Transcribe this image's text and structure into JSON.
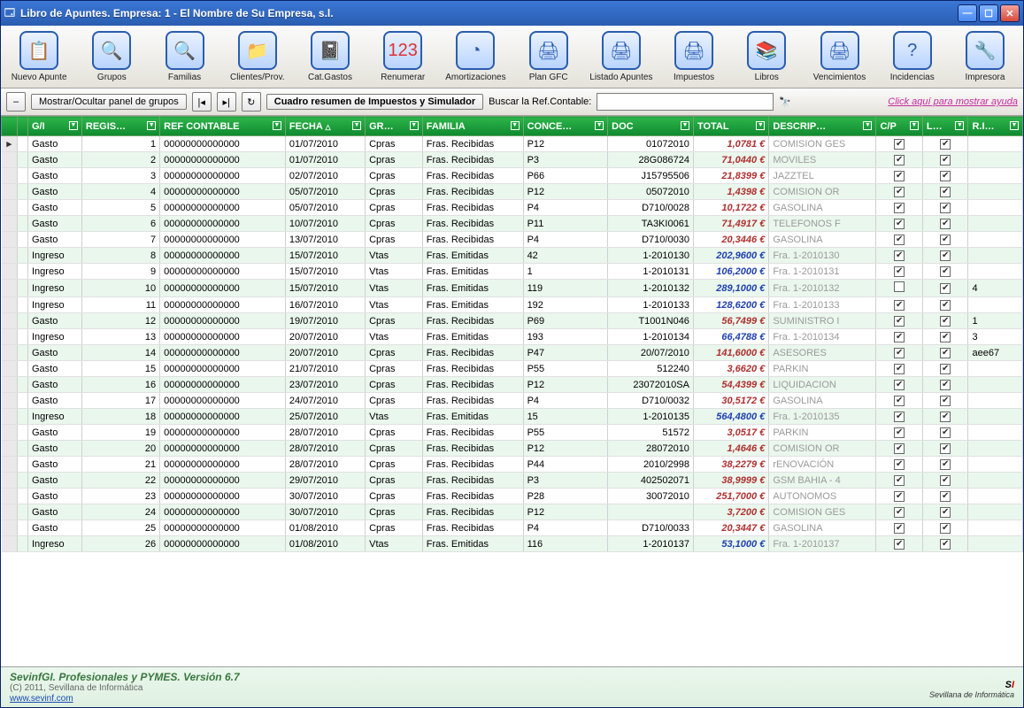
{
  "window": {
    "title": "Libro de Apuntes. Empresa: 1 - El Nombre de Su Empresa, s.l."
  },
  "toolbar_items": [
    {
      "label": "Nuevo Apunte",
      "icon": "📋",
      "name": "nuevo-apunte"
    },
    {
      "label": "Grupos",
      "icon": "🔍",
      "name": "grupos"
    },
    {
      "label": "Familias",
      "icon": "🔍",
      "name": "familias"
    },
    {
      "label": "Clientes/Prov.",
      "icon": "📁",
      "name": "clientes-prov"
    },
    {
      "label": "Cat.Gastos",
      "icon": "📓",
      "name": "cat-gastos"
    },
    {
      "label": "Renumerar",
      "icon": "123",
      "name": "renumerar",
      "red": true
    },
    {
      "label": "Amortizaciones",
      "icon": "◔",
      "name": "amortizaciones"
    },
    {
      "label": "Plan GFC",
      "icon": "🖨",
      "name": "plan-gfc"
    },
    {
      "label": "Listado Apuntes",
      "icon": "🖨",
      "name": "listado-apuntes"
    },
    {
      "label": "Impuestos",
      "icon": "🖨",
      "name": "impuestos"
    },
    {
      "label": "Libros",
      "icon": "📚",
      "name": "libros"
    },
    {
      "label": "Vencimientos",
      "icon": "🖨",
      "name": "vencimientos"
    },
    {
      "label": "Incidencias",
      "icon": "?",
      "name": "incidencias"
    },
    {
      "label": "Impresora",
      "icon": "🔧",
      "name": "impresora"
    }
  ],
  "toolbar2": {
    "toggle_panel": "Mostrar/Ocultar panel de grupos",
    "cuadro": "Cuadro resumen de Impuestos y Simulador",
    "buscar_label": "Buscar la Ref.Contable:",
    "help": "Click aquí para mostrar ayuda"
  },
  "columns": [
    "",
    "",
    "G/I",
    "REGIS…",
    "REF CONTABLE",
    "FECHA",
    "GR…",
    "FAMILIA",
    "CONCE…",
    "DOC",
    "TOTAL",
    "DESCRIP…",
    "C/P",
    "L…",
    "R.I…"
  ],
  "rows": [
    {
      "sel": true,
      "gi": "Gasto",
      "reg": 1,
      "ref": "00000000000000",
      "fecha": "01/07/2010",
      "gr": "Cpras",
      "familia": "Fras. Recibidas",
      "conc": "P12",
      "doc": "01072010",
      "total": "1,0781 €",
      "tc": "red",
      "desc": "COMISION GES",
      "cp": true,
      "l": true,
      "ri": ""
    },
    {
      "gi": "Gasto",
      "reg": 2,
      "ref": "00000000000000",
      "fecha": "01/07/2010",
      "gr": "Cpras",
      "familia": "Fras. Recibidas",
      "conc": "P3",
      "doc": "28G086724",
      "total": "71,0440 €",
      "tc": "red",
      "desc": "MOVILES",
      "cp": true,
      "l": true,
      "ri": ""
    },
    {
      "gi": "Gasto",
      "reg": 3,
      "ref": "00000000000000",
      "fecha": "02/07/2010",
      "gr": "Cpras",
      "familia": "Fras. Recibidas",
      "conc": "P66",
      "doc": "J15795506",
      "total": "21,8399 €",
      "tc": "red",
      "desc": "JAZZTEL",
      "cp": true,
      "l": true,
      "ri": ""
    },
    {
      "gi": "Gasto",
      "reg": 4,
      "ref": "00000000000000",
      "fecha": "05/07/2010",
      "gr": "Cpras",
      "familia": "Fras. Recibidas",
      "conc": "P12",
      "doc": "05072010",
      "total": "1,4398 €",
      "tc": "red",
      "desc": "COMISION OR",
      "cp": true,
      "l": true,
      "ri": ""
    },
    {
      "gi": "Gasto",
      "reg": 5,
      "ref": "00000000000000",
      "fecha": "05/07/2010",
      "gr": "Cpras",
      "familia": "Fras. Recibidas",
      "conc": "P4",
      "doc": "D710/0028",
      "total": "10,1722 €",
      "tc": "red",
      "desc": "GASOLINA",
      "cp": true,
      "l": true,
      "ri": ""
    },
    {
      "gi": "Gasto",
      "reg": 6,
      "ref": "00000000000000",
      "fecha": "10/07/2010",
      "gr": "Cpras",
      "familia": "Fras. Recibidas",
      "conc": "P11",
      "doc": "TA3KI0061",
      "total": "71,4917 €",
      "tc": "red",
      "desc": "TELEFONOS F",
      "cp": true,
      "l": true,
      "ri": ""
    },
    {
      "gi": "Gasto",
      "reg": 7,
      "ref": "00000000000000",
      "fecha": "13/07/2010",
      "gr": "Cpras",
      "familia": "Fras. Recibidas",
      "conc": "P4",
      "doc": "D710/0030",
      "total": "20,3446 €",
      "tc": "red",
      "desc": "GASOLINA",
      "cp": true,
      "l": true,
      "ri": ""
    },
    {
      "gi": "Ingreso",
      "reg": 8,
      "ref": "00000000000000",
      "fecha": "15/07/2010",
      "gr": "Vtas",
      "familia": "Fras. Emitidas",
      "conc": "42",
      "doc": "1-2010130",
      "total": "202,9600 €",
      "tc": "blue",
      "desc": "Fra. 1-2010130",
      "cp": true,
      "l": true,
      "ri": ""
    },
    {
      "gi": "Ingreso",
      "reg": 9,
      "ref": "00000000000000",
      "fecha": "15/07/2010",
      "gr": "Vtas",
      "familia": "Fras. Emitidas",
      "conc": "1",
      "doc": "1-2010131",
      "total": "106,2000 €",
      "tc": "blue",
      "desc": "Fra. 1-2010131",
      "cp": true,
      "l": true,
      "ri": ""
    },
    {
      "gi": "Ingreso",
      "reg": 10,
      "ref": "00000000000000",
      "fecha": "15/07/2010",
      "gr": "Vtas",
      "familia": "Fras. Emitidas",
      "conc": "119",
      "doc": "1-2010132",
      "total": "289,1000 €",
      "tc": "blue",
      "desc": "Fra. 1-2010132",
      "cp": false,
      "l": true,
      "ri": "4"
    },
    {
      "gi": "Ingreso",
      "reg": 11,
      "ref": "00000000000000",
      "fecha": "16/07/2010",
      "gr": "Vtas",
      "familia": "Fras. Emitidas",
      "conc": "192",
      "doc": "1-2010133",
      "total": "128,6200 €",
      "tc": "blue",
      "desc": "Fra. 1-2010133",
      "cp": true,
      "l": true,
      "ri": ""
    },
    {
      "gi": "Gasto",
      "reg": 12,
      "ref": "00000000000000",
      "fecha": "19/07/2010",
      "gr": "Cpras",
      "familia": "Fras. Recibidas",
      "conc": "P69",
      "doc": "T1001N046",
      "total": "56,7499 €",
      "tc": "red",
      "desc": "SUMINISTRO I",
      "cp": true,
      "l": true,
      "ri": "1"
    },
    {
      "gi": "Ingreso",
      "reg": 13,
      "ref": "00000000000000",
      "fecha": "20/07/2010",
      "gr": "Vtas",
      "familia": "Fras. Emitidas",
      "conc": "193",
      "doc": "1-2010134",
      "total": "66,4788 €",
      "tc": "blue",
      "desc": "Fra. 1-2010134",
      "cp": true,
      "l": true,
      "ri": "3"
    },
    {
      "gi": "Gasto",
      "reg": 14,
      "ref": "00000000000000",
      "fecha": "20/07/2010",
      "gr": "Cpras",
      "familia": "Fras. Recibidas",
      "conc": "P47",
      "doc": "20/07/2010",
      "total": "141,6000 €",
      "tc": "red",
      "desc": "ASESORES",
      "cp": true,
      "l": true,
      "ri": "aee67"
    },
    {
      "gi": "Gasto",
      "reg": 15,
      "ref": "00000000000000",
      "fecha": "21/07/2010",
      "gr": "Cpras",
      "familia": "Fras. Recibidas",
      "conc": "P55",
      "doc": "512240",
      "total": "3,6620 €",
      "tc": "red",
      "desc": "PARKIN",
      "cp": true,
      "l": true,
      "ri": ""
    },
    {
      "gi": "Gasto",
      "reg": 16,
      "ref": "00000000000000",
      "fecha": "23/07/2010",
      "gr": "Cpras",
      "familia": "Fras. Recibidas",
      "conc": "P12",
      "doc": "23072010SA",
      "total": "54,4399 €",
      "tc": "red",
      "desc": "LIQUIDACION",
      "cp": true,
      "l": true,
      "ri": ""
    },
    {
      "gi": "Gasto",
      "reg": 17,
      "ref": "00000000000000",
      "fecha": "24/07/2010",
      "gr": "Cpras",
      "familia": "Fras. Recibidas",
      "conc": "P4",
      "doc": "D710/0032",
      "total": "30,5172 €",
      "tc": "red",
      "desc": "GASOLINA",
      "cp": true,
      "l": true,
      "ri": ""
    },
    {
      "gi": "Ingreso",
      "reg": 18,
      "ref": "00000000000000",
      "fecha": "25/07/2010",
      "gr": "Vtas",
      "familia": "Fras. Emitidas",
      "conc": "15",
      "doc": "1-2010135",
      "total": "564,4800 €",
      "tc": "blue",
      "desc": "Fra. 1-2010135",
      "cp": true,
      "l": true,
      "ri": ""
    },
    {
      "gi": "Gasto",
      "reg": 19,
      "ref": "00000000000000",
      "fecha": "28/07/2010",
      "gr": "Cpras",
      "familia": "Fras. Recibidas",
      "conc": "P55",
      "doc": "51572",
      "total": "3,0517 €",
      "tc": "red",
      "desc": "PARKIN",
      "cp": true,
      "l": true,
      "ri": ""
    },
    {
      "gi": "Gasto",
      "reg": 20,
      "ref": "00000000000000",
      "fecha": "28/07/2010",
      "gr": "Cpras",
      "familia": "Fras. Recibidas",
      "conc": "P12",
      "doc": "28072010",
      "total": "1,4646 €",
      "tc": "red",
      "desc": "COMISION OR",
      "cp": true,
      "l": true,
      "ri": ""
    },
    {
      "gi": "Gasto",
      "reg": 21,
      "ref": "00000000000000",
      "fecha": "28/07/2010",
      "gr": "Cpras",
      "familia": "Fras. Recibidas",
      "conc": "P44",
      "doc": "2010/2998",
      "total": "38,2279 €",
      "tc": "red",
      "desc": "rENOVACIÓN",
      "cp": true,
      "l": true,
      "ri": ""
    },
    {
      "gi": "Gasto",
      "reg": 22,
      "ref": "00000000000000",
      "fecha": "29/07/2010",
      "gr": "Cpras",
      "familia": "Fras. Recibidas",
      "conc": "P3",
      "doc": "402502071",
      "total": "38,9999 €",
      "tc": "red",
      "desc": "GSM BAHIA - 4",
      "cp": true,
      "l": true,
      "ri": ""
    },
    {
      "gi": "Gasto",
      "reg": 23,
      "ref": "00000000000000",
      "fecha": "30/07/2010",
      "gr": "Cpras",
      "familia": "Fras. Recibidas",
      "conc": "P28",
      "doc": "30072010",
      "total": "251,7000 €",
      "tc": "red",
      "desc": "AUTONOMOS",
      "cp": true,
      "l": true,
      "ri": ""
    },
    {
      "gi": "Gasto",
      "reg": 24,
      "ref": "00000000000000",
      "fecha": "30/07/2010",
      "gr": "Cpras",
      "familia": "Fras. Recibidas",
      "conc": "P12",
      "doc": "",
      "total": "3,7200 €",
      "tc": "red",
      "desc": "COMISION GES",
      "cp": true,
      "l": true,
      "ri": ""
    },
    {
      "gi": "Gasto",
      "reg": 25,
      "ref": "00000000000000",
      "fecha": "01/08/2010",
      "gr": "Cpras",
      "familia": "Fras. Recibidas",
      "conc": "P4",
      "doc": "D710/0033",
      "total": "20,3447 €",
      "tc": "red",
      "desc": "GASOLINA",
      "cp": true,
      "l": true,
      "ri": ""
    },
    {
      "gi": "Ingreso",
      "reg": 26,
      "ref": "00000000000000",
      "fecha": "01/08/2010",
      "gr": "Vtas",
      "familia": "Fras. Emitidas",
      "conc": "116",
      "doc": "1-2010137",
      "total": "53,1000 €",
      "tc": "blue",
      "desc": "Fra. 1-2010137",
      "cp": true,
      "l": true,
      "ri": ""
    }
  ],
  "status": {
    "product": "SevinfGI. Profesionales y PYMES. Versión 6.7",
    "copyright": "(C) 2011, Sevillana de Informática",
    "url": "www.sevinf.com",
    "logo_main": "SI",
    "logo_sub": "Sevillana de Informática"
  }
}
